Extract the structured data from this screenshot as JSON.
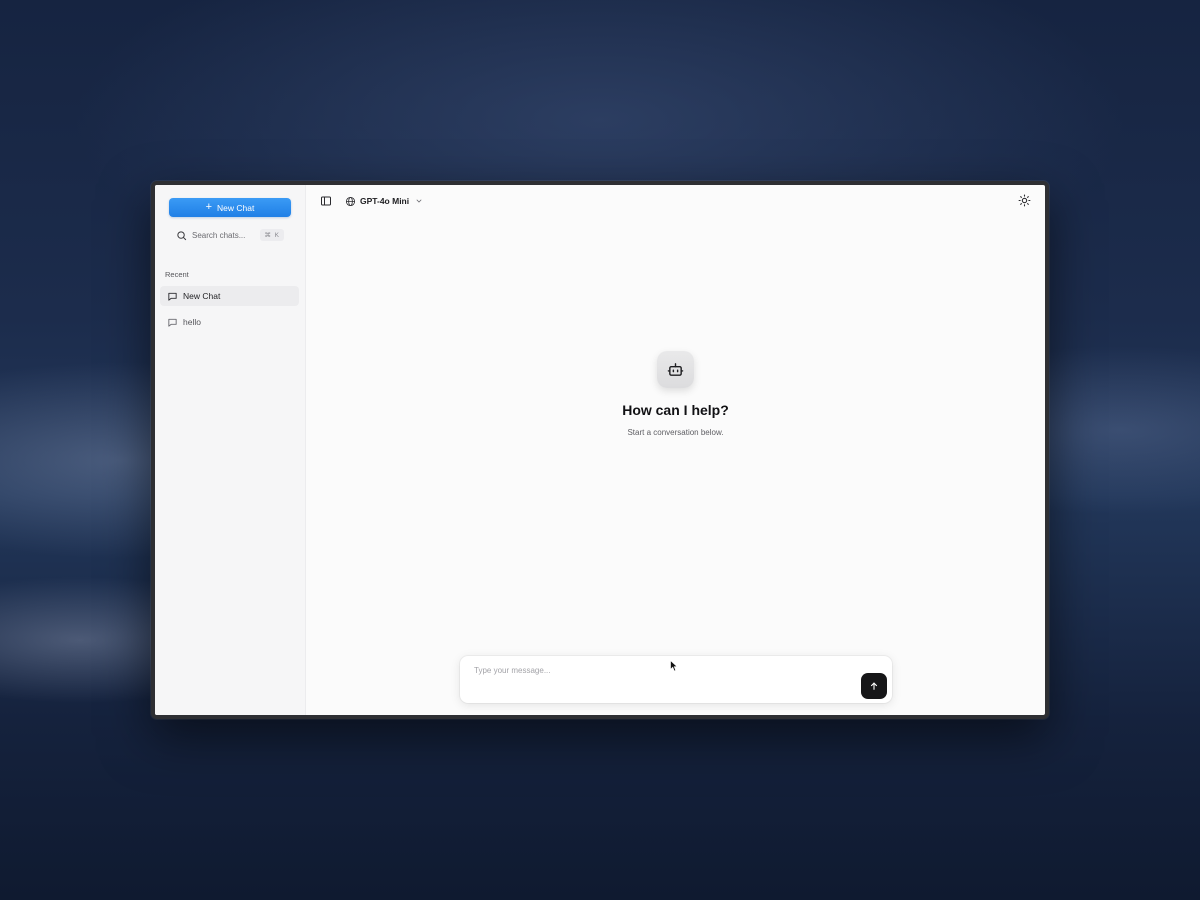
{
  "sidebar": {
    "new_chat_label": "New Chat",
    "new_chat_plus": "+",
    "search": {
      "placeholder": "Search chats...",
      "shortcut": "⌘ K"
    },
    "recent_label": "Recent",
    "items": [
      {
        "label": "New Chat",
        "active": true
      },
      {
        "label": "hello",
        "active": false
      }
    ]
  },
  "header": {
    "model_name": "GPT-4o Mini"
  },
  "main": {
    "hero_title": "How can I help?",
    "hero_subtitle": "Start a conversation below."
  },
  "composer": {
    "placeholder": "Type your message..."
  },
  "colors": {
    "accent": "#1f7fe6",
    "send_button": "#161618"
  },
  "icons": {
    "sidebar_toggle": "sidebar-toggle-icon",
    "model": "globe-icon",
    "theme": "sun-icon",
    "bot": "bot-icon",
    "send": "arrow-up-icon",
    "chat": "message-icon",
    "search": "search-icon"
  }
}
